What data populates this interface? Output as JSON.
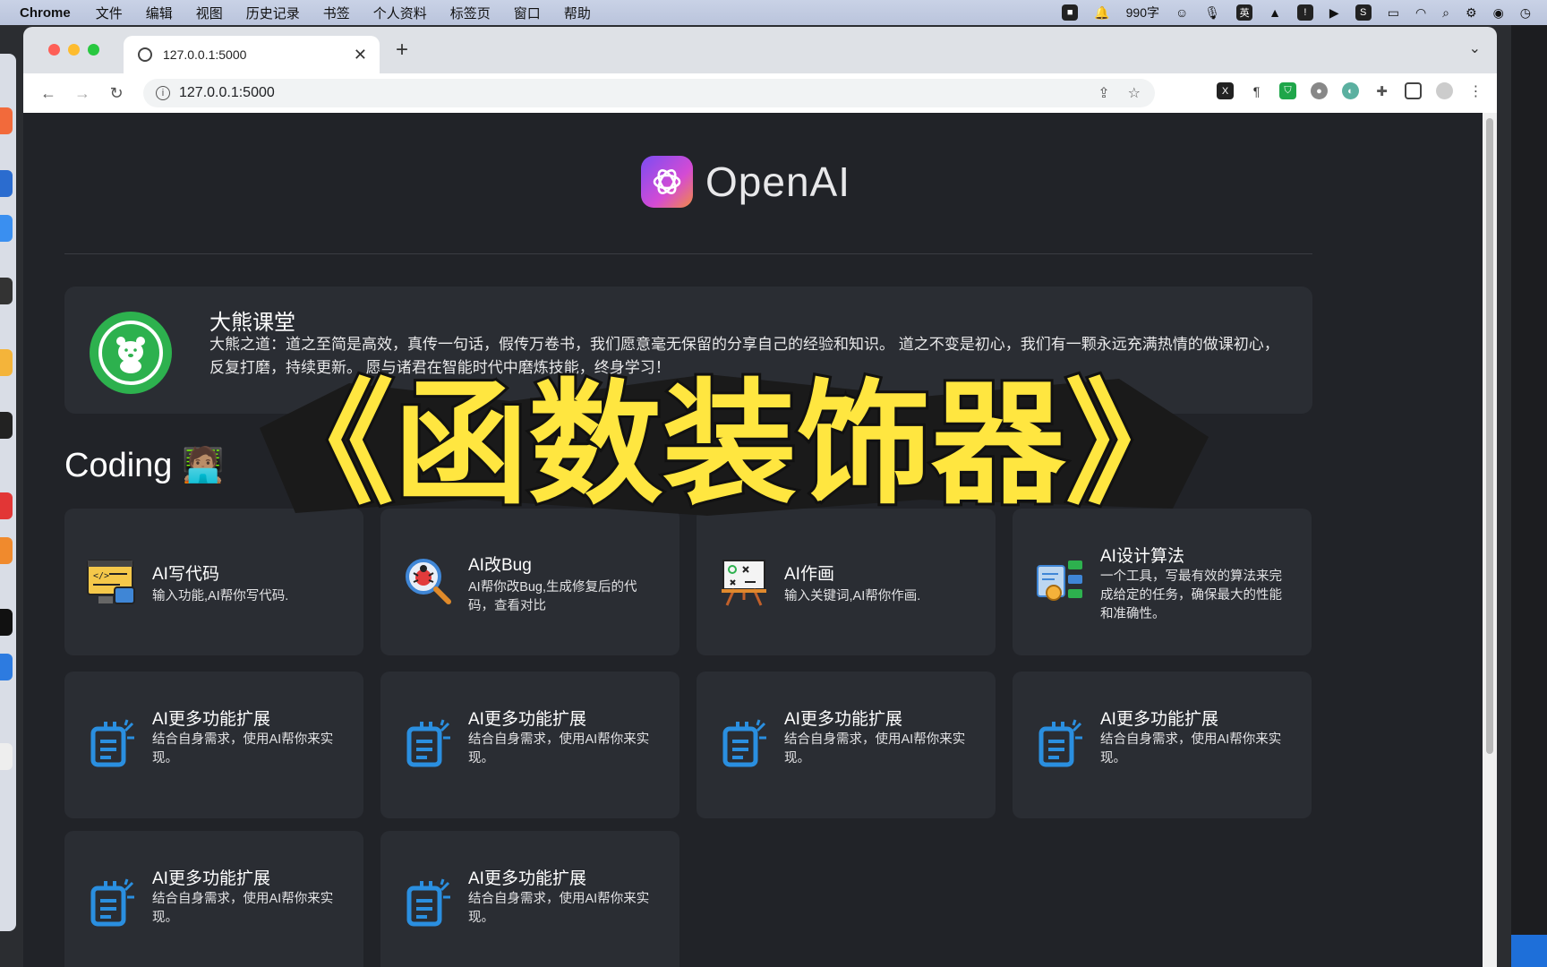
{
  "menubar": {
    "app": "Chrome",
    "items": [
      "文件",
      "编辑",
      "视图",
      "历史记录",
      "书签",
      "个人资料",
      "标签页",
      "窗口",
      "帮助"
    ],
    "word_count": "990字",
    "ime": "英"
  },
  "browser": {
    "tab_title": "127.0.0.1:5000",
    "url": "127.0.0.1:5000"
  },
  "page": {
    "logo_text": "OpenAI",
    "hero": {
      "title": "大熊课堂",
      "description": "大熊之道：道之至简是高效，真传一句话，假传万卷书，我们愿意毫无保留的分享自己的经验和知识。 道之不变是初心，我们有一颗永远充满热情的做课初心，反复打磨，持续更新。 愿与诸君在智能时代中磨炼技能，终身学习！"
    },
    "section_title": "Coding 🧑🏽‍💻",
    "overlay_title": "《函数装饰器》",
    "cards": [
      {
        "title": "AI写代码",
        "desc": "输入功能,AI帮你写代码.",
        "icon": "code-editor-icon"
      },
      {
        "title": "AI改Bug",
        "desc": "AI帮你改Bug,生成修复后的代码，查看对比",
        "icon": "bug-search-icon"
      },
      {
        "title": "AI作画",
        "desc": "输入关键词,AI帮你作画.",
        "icon": "easel-icon"
      },
      {
        "title": "AI设计算法",
        "desc": "一个工具，写最有效的算法来完成给定的任务，确保最大的性能和准确性。",
        "icon": "algorithm-icon"
      },
      {
        "title": "AI更多功能扩展",
        "desc": "结合自身需求，使用AI帮你来实现。",
        "icon": "notepad-icon"
      },
      {
        "title": "AI更多功能扩展",
        "desc": "结合自身需求，使用AI帮你来实现。",
        "icon": "notepad-icon"
      },
      {
        "title": "AI更多功能扩展",
        "desc": "结合自身需求，使用AI帮你来实现。",
        "icon": "notepad-icon"
      },
      {
        "title": "AI更多功能扩展",
        "desc": "结合自身需求，使用AI帮你来实现。",
        "icon": "notepad-icon"
      },
      {
        "title": "AI更多功能扩展",
        "desc": "结合自身需求，使用AI帮你来实现。",
        "icon": "notepad-icon"
      },
      {
        "title": "AI更多功能扩展",
        "desc": "结合自身需求，使用AI帮你来实现。",
        "icon": "notepad-icon"
      }
    ]
  },
  "colors": {
    "page_bg": "#212328",
    "card_bg": "#2a2d33",
    "accent_blue": "#2a8fe0",
    "brand_green": "#2db14e",
    "overlay_yellow": "#ffe640"
  }
}
